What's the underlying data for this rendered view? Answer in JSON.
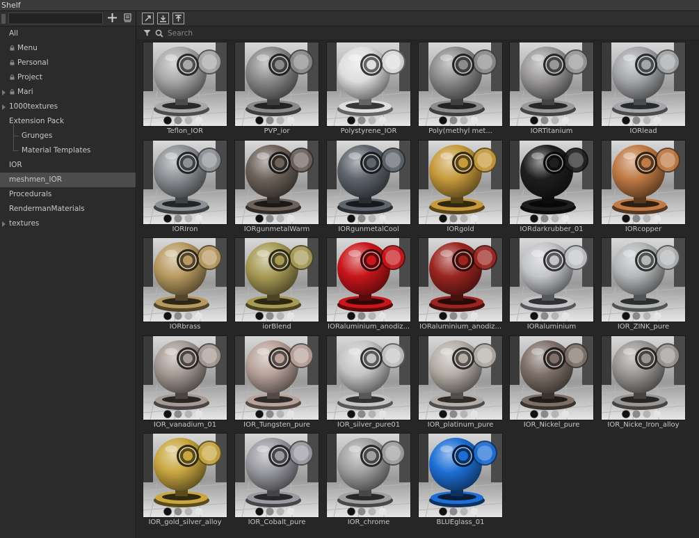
{
  "window": {
    "title": "Shelf"
  },
  "search": {
    "placeholder": "Search"
  },
  "tree": [
    {
      "label": "All",
      "kind": "plain"
    },
    {
      "label": "Menu",
      "kind": "locked"
    },
    {
      "label": "Personal",
      "kind": "locked"
    },
    {
      "label": "Project",
      "kind": "locked"
    },
    {
      "label": "Mari",
      "kind": "collapsed-locked"
    },
    {
      "label": "1000textures",
      "kind": "collapsed"
    },
    {
      "label": "Extension Pack",
      "kind": "expanded"
    },
    {
      "label": "Grunges",
      "kind": "child"
    },
    {
      "label": "Material Templates",
      "kind": "child-last"
    },
    {
      "label": "IOR",
      "kind": "plain"
    },
    {
      "label": "meshmen_IOR",
      "kind": "plain",
      "selected": true
    },
    {
      "label": "Procedurals",
      "kind": "plain"
    },
    {
      "label": "RendermanMaterials",
      "kind": "plain"
    },
    {
      "label": "textures",
      "kind": "collapsed"
    }
  ],
  "materials": [
    {
      "label": "Teflon_IOR",
      "color": "#a8a8a8"
    },
    {
      "label": "PVP_ior",
      "color": "#8a8a8a"
    },
    {
      "label": "Polystyrene_IOR",
      "color": "#dedede"
    },
    {
      "label": "Poly(methyl met...",
      "color": "#8c8c8c"
    },
    {
      "label": "IORTitanium",
      "color": "#9a9898"
    },
    {
      "label": "IORlead",
      "color": "#a4a6aa"
    },
    {
      "label": "IORIron",
      "color": "#8d9095"
    },
    {
      "label": "IORgunmetalWarm",
      "color": "#6d625a"
    },
    {
      "label": "IORgunmetalCool",
      "color": "#5e646c"
    },
    {
      "label": "IORgold",
      "color": "#c79a3c"
    },
    {
      "label": "IORdarkrubber_01",
      "color": "#1e1e1e"
    },
    {
      "label": "IORcopper",
      "color": "#c07a45"
    },
    {
      "label": "IORbrass",
      "color": "#b89a60"
    },
    {
      "label": "iorBlend",
      "color": "#a79a55"
    },
    {
      "label": "IORaluminium_anodiz...",
      "color": "#c8161a"
    },
    {
      "label": "IORaluminium_anodiz...",
      "color": "#9a2520"
    },
    {
      "label": "IORaluminium",
      "color": "#c2c4c8"
    },
    {
      "label": "IOR_ZINK_pure",
      "color": "#b4b6b8"
    },
    {
      "label": "IOR_vanadium_01",
      "color": "#a59a94"
    },
    {
      "label": "IOR_Tungsten_pure",
      "color": "#b8a29a"
    },
    {
      "label": "IOR_silver_pure01",
      "color": "#c4c4c4"
    },
    {
      "label": "IOR_platinum_pure",
      "color": "#b4ada6"
    },
    {
      "label": "IOR_Nickel_pure",
      "color": "#7e7068"
    },
    {
      "label": "IOR_Nicke_Iron_alloy",
      "color": "#9a9694"
    },
    {
      "label": "IOR_gold_silver_alloy",
      "color": "#c9a640"
    },
    {
      "label": "IOR_Cobalt_pure",
      "color": "#9a9aa2"
    },
    {
      "label": "IOR_chrome",
      "color": "#a0a0a0"
    },
    {
      "label": "BLUEglass_01",
      "color": "#1d6fd6"
    }
  ]
}
